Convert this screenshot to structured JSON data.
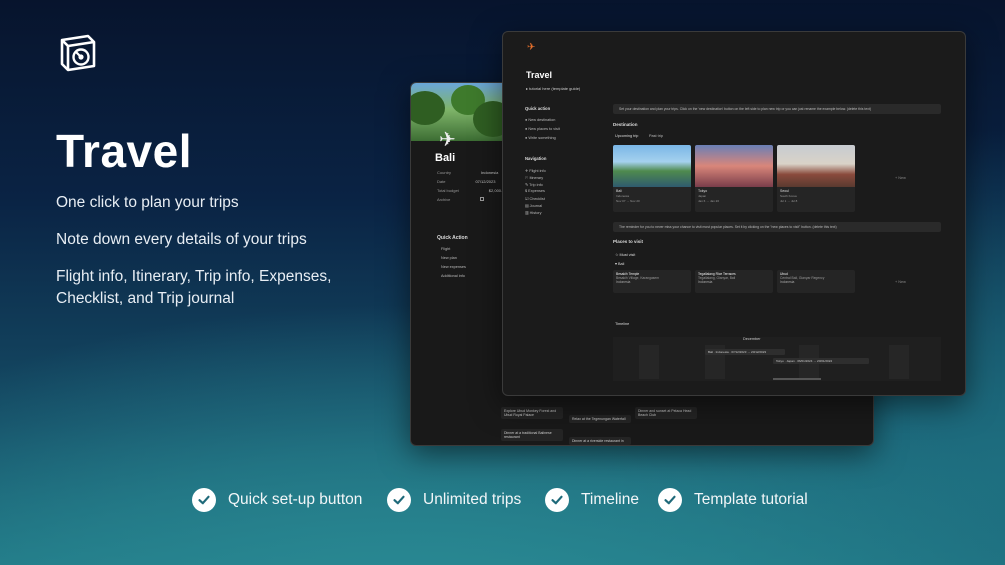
{
  "hero": {
    "title": "Travel",
    "lines": [
      "One click to plan your trips",
      "Note down every details of your trips",
      "Flight info, Itinerary, Trip info, Expenses, Checklist, and Trip journal"
    ]
  },
  "back_window": {
    "page_title": "Bali",
    "properties": [
      {
        "label": "Country",
        "value": "Indonesia"
      },
      {
        "label": "Date",
        "value": "07/12/2023"
      },
      {
        "label": "Total budget",
        "value": "$2,000.00"
      },
      {
        "label": "Archive",
        "value": ""
      }
    ],
    "quick_action_heading": "Quick Action",
    "quick_actions": [
      "Flight",
      "New plan",
      "New expenses",
      "Additional info"
    ],
    "itinerary_cards": [
      "Explore Ubud Monkey Forest and Ubud Royal Palace",
      "Relax at the Tegenungan Waterfall",
      "Dinner and sunset at Pelaca Head Beach Club",
      "Dinner at a traditional Balinese restaurant",
      "Dinner at a riverside restaurant in"
    ]
  },
  "front_window": {
    "page_title": "Travel",
    "toggle": "tutorial here (template guide)",
    "quick_action_heading": "Quick action",
    "quick_actions": [
      "New destination",
      "New places to visit",
      "Write something"
    ],
    "navigation_heading": "Navigation",
    "navigation": [
      "Flight info",
      "Itinerary",
      "Trip info",
      "Expenses",
      "Checklist",
      "Journal",
      "History"
    ],
    "callout_1": "Set your destination and plan your trips. Click on the 'new destination' button on the left side to plan new trip or you can just rename the example below. (delete this text)",
    "destination_heading": "Destination",
    "destination_tabs": [
      "Upcoming trip",
      "Past trip"
    ],
    "destinations": [
      {
        "name": "Bali",
        "country": "Indonesia",
        "date": "Nov 07 → Nov 20"
      },
      {
        "name": "Tokyo",
        "country": "Japan",
        "date": "Jan 6 → Jan 20"
      },
      {
        "name": "Seoul",
        "country": "South Korea",
        "date": "Jul 1 → Jul 8"
      }
    ],
    "new_label": "+ New",
    "callout_2": "The reminder for you to never miss your chance to visit most popular places. Set it by clicking on the \"new places to visit\" button. (delete this text)",
    "places_heading": "Places to visit",
    "places_filter": "Must visit",
    "places_group": "Bali",
    "places": [
      {
        "name": "Besakih Temple",
        "area": "Besakih Village, Karangasem",
        "tag": "Indonesia"
      },
      {
        "name": "Tegallalang Rice Terraces",
        "area": "Tegallalang, Gianyar, Bali",
        "tag": "Indonesia"
      },
      {
        "name": "Ubud",
        "area": "Central Bali, Gianyar Regency",
        "tag": "Indonesia"
      }
    ],
    "timeline_label": "Timeline",
    "timeline_month": "December",
    "timeline_items": [
      {
        "label": "Bali · Indonesia · 07/12/2023 → 20/12/2023"
      },
      {
        "label": "Tokyo · Japan · 06/01/2024 → 20/01/2024"
      }
    ]
  },
  "features": [
    "Quick set-up button",
    "Unlimited trips",
    "Timeline",
    "Template tutorial"
  ],
  "colors": {
    "accent_orange": "#e8712c",
    "check_fill": "#ffffff",
    "window_bg": "#191919"
  }
}
